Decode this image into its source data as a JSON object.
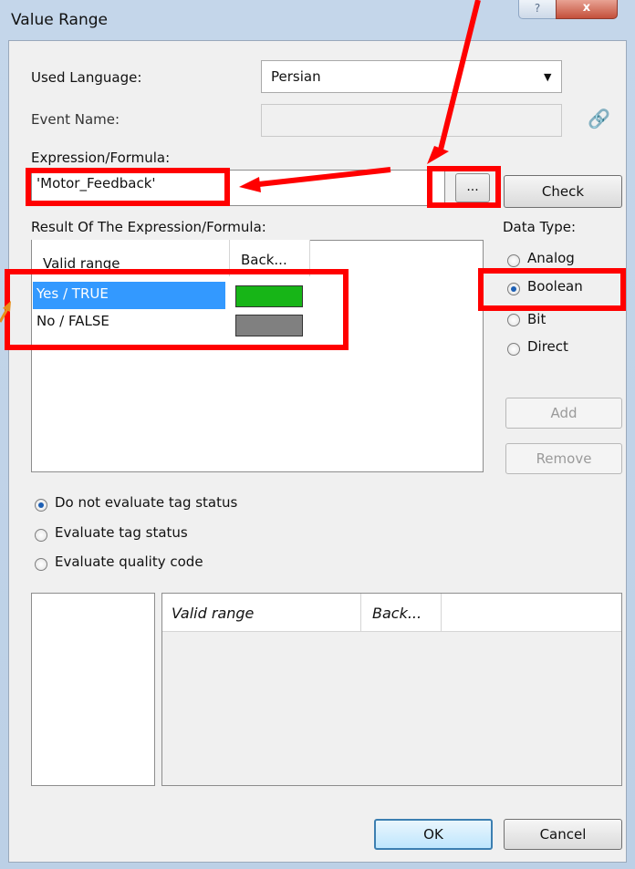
{
  "window": {
    "title": "Value Range",
    "help_glyph": "?",
    "close_glyph": "x"
  },
  "form": {
    "used_language_label": "Used Language:",
    "used_language_value": "Persian",
    "dropdown_arrow": "▼",
    "event_name_label": "Event Name:",
    "event_icon_glyph": "🔗",
    "expression_label": "Expression/Formula:",
    "expression_value": "'Motor_Feedback'",
    "browse_label": "...",
    "check_label": "Check",
    "result_label": "Result Of The Expression/Formula:"
  },
  "result_table": {
    "columns": [
      "Valid range",
      "Back..."
    ],
    "rows": [
      {
        "label": "Yes / TRUE",
        "color": "#17b517",
        "selected": true
      },
      {
        "label": "No / FALSE",
        "color": "#808080",
        "selected": false
      }
    ]
  },
  "data_type": {
    "label": "Data Type:",
    "options": [
      "Analog",
      "Boolean",
      "Bit",
      "Direct"
    ],
    "selected": "Boolean"
  },
  "side_buttons": {
    "add": "Add",
    "remove": "Remove"
  },
  "tag_status": {
    "options": [
      "Do not evaluate tag status",
      "Evaluate tag status",
      "Evaluate quality code"
    ],
    "selected": "Do not evaluate tag status"
  },
  "quality_table": {
    "columns": [
      "Valid range",
      "Back..."
    ]
  },
  "dialog_buttons": {
    "ok": "OK",
    "cancel": "Cancel"
  },
  "colors": {
    "annotation_red": "#ff0000",
    "annotation_orange": "#e8901a",
    "selection_blue": "#3399ff"
  }
}
